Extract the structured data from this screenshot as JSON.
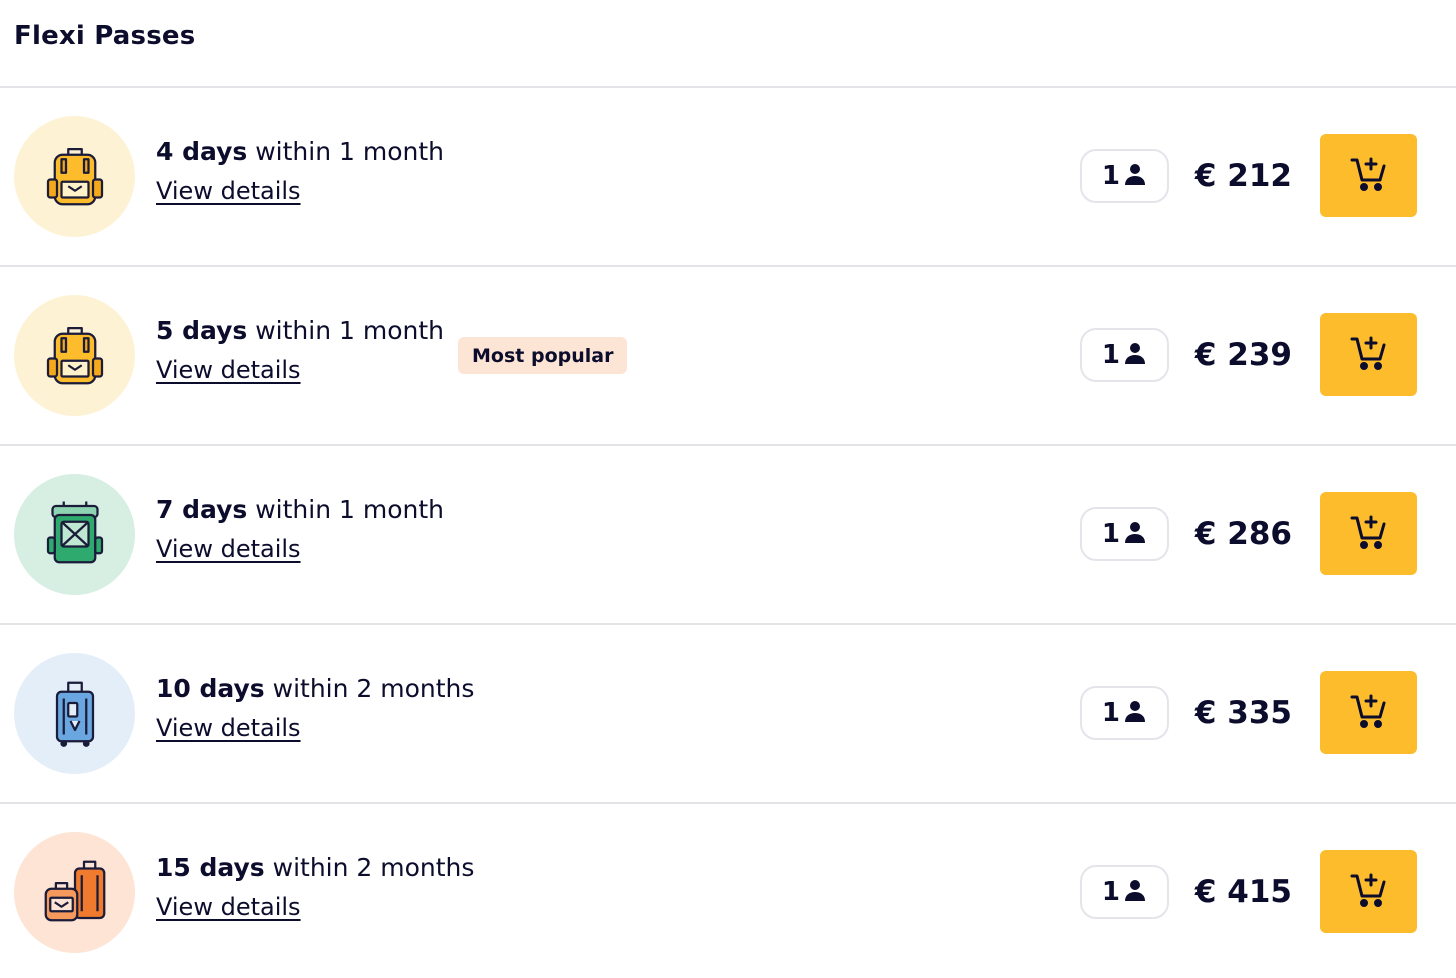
{
  "header": {
    "title": "Flexi Passes"
  },
  "colors": {
    "accent": "#fcbc2c",
    "text": "#0c0c2c",
    "badge_bg": "#fde5d6",
    "divider": "#e4e4e8"
  },
  "passes": [
    {
      "days_label": "4 days",
      "within_label": "within 1 month",
      "details_label": "View details",
      "badge": null,
      "passengers": "1",
      "price": "€ 212",
      "icon": "backpack-icon",
      "avatar_bg": "#fef2d4"
    },
    {
      "days_label": "5 days",
      "within_label": "within 1 month",
      "details_label": "View details",
      "badge": "Most popular",
      "passengers": "1",
      "price": "€ 239",
      "icon": "backpack-icon",
      "avatar_bg": "#fef2d4"
    },
    {
      "days_label": "7 days",
      "within_label": "within 1 month",
      "details_label": "View details",
      "badge": null,
      "passengers": "1",
      "price": "€ 286",
      "icon": "hiking-backpack-icon",
      "avatar_bg": "#d6efe2"
    },
    {
      "days_label": "10 days",
      "within_label": "within 2 months",
      "details_label": "View details",
      "badge": null,
      "passengers": "1",
      "price": "€ 335",
      "icon": "suitcase-icon",
      "avatar_bg": "#e3eef8"
    },
    {
      "days_label": "15 days",
      "within_label": "within 2 months",
      "details_label": "View details",
      "badge": null,
      "passengers": "1",
      "price": "€ 415",
      "icon": "luggage-set-icon",
      "avatar_bg": "#fde4d4"
    }
  ]
}
